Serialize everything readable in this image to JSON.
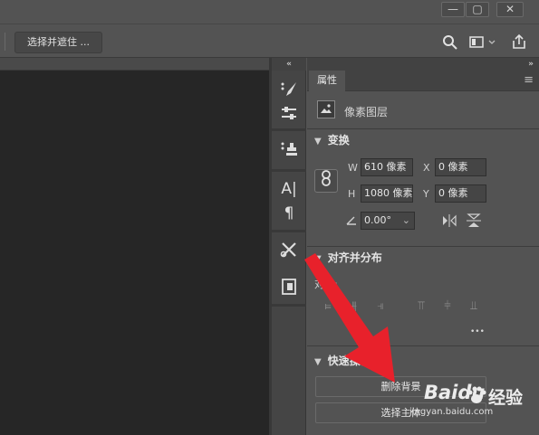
{
  "optbar": {
    "select_mask_label": "选择并遮住 ..."
  },
  "panel": {
    "tab_label": "属性",
    "layer_type": "像素图层",
    "transform": {
      "title": "变换",
      "w_label": "W",
      "w_value": "610 像素",
      "x_label": "X",
      "x_value": "0 像素",
      "h_label": "H",
      "h_value": "1080 像素",
      "y_label": "Y",
      "y_value": "0 像素",
      "angle_value": "0.00°"
    },
    "align": {
      "title": "对齐并分布",
      "sub_label": "对齐:",
      "more": "•••"
    },
    "quick": {
      "title": "快速操作",
      "remove_bg": "删除背景",
      "select_subject": "选择主体"
    }
  },
  "watermark": {
    "brand": "Baidu",
    "brand_cn": "经验",
    "url": "jingyan.baidu.com"
  },
  "colors": {
    "arrow": "#e8212b",
    "panel": "#535353",
    "canvas": "#262626"
  }
}
